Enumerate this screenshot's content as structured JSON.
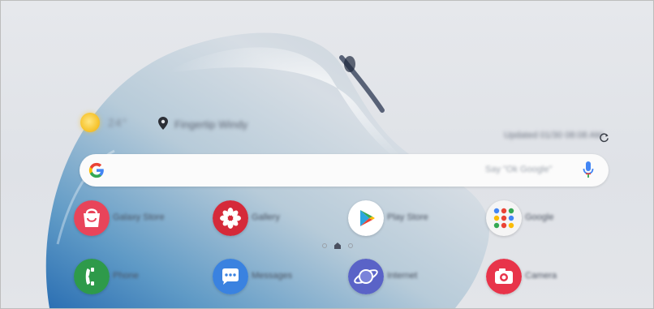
{
  "status": {
    "temperature": "24°",
    "location": "Fingertip Windy",
    "updated": "Updated 01/30 08:08 AM"
  },
  "search": {
    "hint": "Say \"Ok Google\""
  },
  "apps": [
    {
      "label": "Galaxy Store",
      "icon": "store-bag-icon",
      "color": "#e8445a"
    },
    {
      "label": "Gallery",
      "icon": "flower-icon",
      "color": "#d52a3a"
    },
    {
      "label": "Play Store",
      "icon": "play-triangle-icon",
      "color": "#ffffff"
    },
    {
      "label": "Google",
      "icon": "folder-grid-icon",
      "color": "#f5f5f5"
    },
    {
      "label": "Phone",
      "icon": "phone-icon",
      "color": "#2e9a4a"
    },
    {
      "label": "Messages",
      "icon": "chat-bubble-icon",
      "color": "#3a82e0"
    },
    {
      "label": "Internet",
      "icon": "planet-icon",
      "color": "#5a63c7"
    },
    {
      "label": "Camera",
      "icon": "camera-icon",
      "color": "#e8344a"
    }
  ],
  "pages": {
    "count": 3,
    "current": 2
  }
}
